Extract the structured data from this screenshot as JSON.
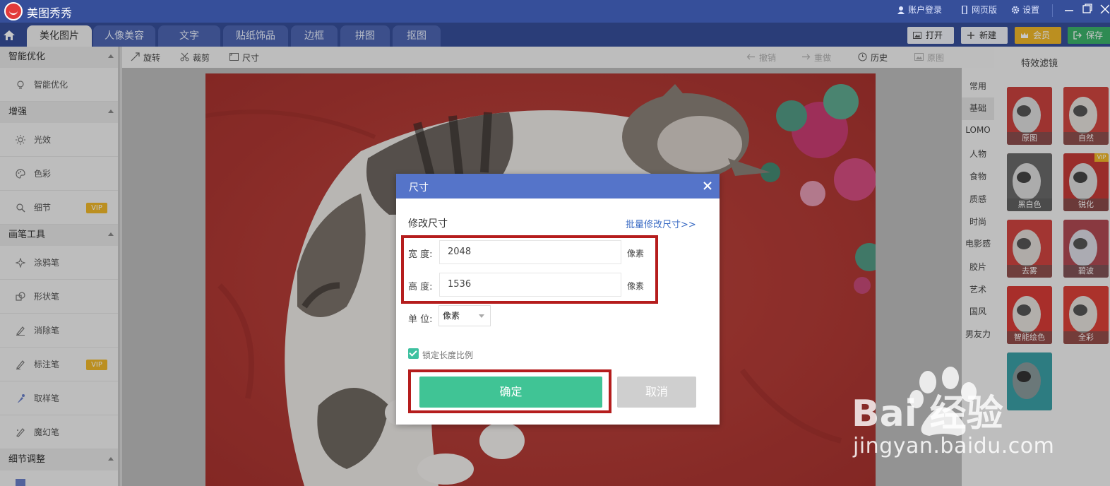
{
  "app": {
    "title": "美图秀秀",
    "account": "账户登录",
    "web_version": "网页版",
    "settings": "设置"
  },
  "tabs": [
    {
      "label": "美化图片",
      "active": true
    },
    {
      "label": "人像美容"
    },
    {
      "label": "文字"
    },
    {
      "label": "贴纸饰品"
    },
    {
      "label": "边框"
    },
    {
      "label": "拼图"
    },
    {
      "label": "抠图"
    }
  ],
  "top_buttons": {
    "open": "打开",
    "new": "新建",
    "vip": "会员",
    "save": "保存"
  },
  "sidebar": {
    "sections": [
      {
        "title": "智能优化",
        "items": [
          {
            "label": "智能优化",
            "icon": "bulb-icon"
          }
        ]
      },
      {
        "title": "增强",
        "items": [
          {
            "label": "光效",
            "icon": "sun-icon"
          },
          {
            "label": "色彩",
            "icon": "palette-icon"
          },
          {
            "label": "细节",
            "icon": "magnifier-icon",
            "badge": "VIP"
          }
        ]
      },
      {
        "title": "画笔工具",
        "items": [
          {
            "label": "涂鸦笔",
            "icon": "sparkle-pen-icon"
          },
          {
            "label": "形状笔",
            "icon": "shape-icon"
          },
          {
            "label": "消除笔",
            "icon": "eraser-pen-icon"
          },
          {
            "label": "标注笔",
            "icon": "marker-pen-icon",
            "badge": "VIP"
          },
          {
            "label": "取样笔",
            "icon": "dropper-icon"
          },
          {
            "label": "魔幻笔",
            "icon": "magic-pen-icon"
          }
        ]
      },
      {
        "title": "细节调整",
        "items": []
      }
    ]
  },
  "toolbar": {
    "rotate": "旋转",
    "crop": "裁剪",
    "size": "尺寸",
    "undo": "撤销",
    "redo": "重做",
    "history": "历史",
    "original": "原图"
  },
  "right_panel": {
    "title": "特效滤镜",
    "categories": [
      "常用",
      "基础",
      "LOMO",
      "人物",
      "食物",
      "质感",
      "时尚",
      "电影感",
      "胶片",
      "艺术",
      "国风",
      "男友力"
    ],
    "selected_category": "基础",
    "filters": [
      {
        "label": "原图"
      },
      {
        "label": "自然"
      },
      {
        "label": "黑白色"
      },
      {
        "label": "锐化",
        "vip": "VIP"
      },
      {
        "label": "去雾"
      },
      {
        "label": "碧波"
      },
      {
        "label": "智能绘色"
      },
      {
        "label": "全彩"
      },
      {
        "label": ""
      }
    ]
  },
  "dialog": {
    "title": "尺寸",
    "subtitle": "修改尺寸",
    "batch_link": "批量修改尺寸>>",
    "width_label": "宽 度:",
    "width_value": "2048",
    "width_unit": "像素",
    "height_label": "高 度:",
    "height_value": "1536",
    "height_unit": "像素",
    "unit_label": "单 位:",
    "unit_value": "像素",
    "lock_ratio": "锁定长度比例",
    "lock_checked": true,
    "ok": "确定",
    "cancel": "取消"
  },
  "watermark": {
    "text": "jingyan.baidu.com",
    "logo": "Bai 经验"
  },
  "colors": {
    "titlebar": "#364f9a",
    "dialog_header": "#5574c9",
    "ok_button": "#40c495",
    "highlight_box": "#b51d1d",
    "vip": "#f0b82a"
  }
}
